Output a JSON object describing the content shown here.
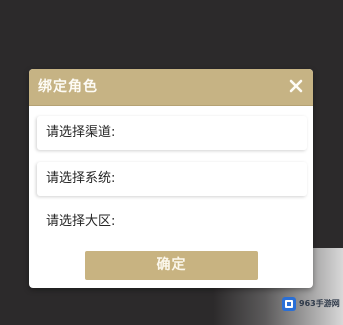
{
  "dialog": {
    "title": "绑定角色",
    "close_icon": "close-icon",
    "fields": [
      {
        "label": "请选择渠道:",
        "value": ""
      },
      {
        "label": "请选择系统:",
        "value": ""
      },
      {
        "label": "请选择大区:",
        "value": ""
      }
    ],
    "confirm_label": "确定"
  },
  "watermark": {
    "text": "963手游网",
    "logo_icon": "watermark-logo-icon"
  },
  "colors": {
    "accent": "#c6b384",
    "background": "#2c2a2b",
    "dialog": "#ffffff"
  }
}
